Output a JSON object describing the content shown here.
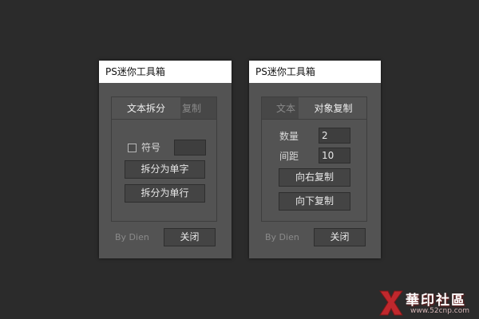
{
  "left_panel": {
    "title": "PS迷你工具箱",
    "tabs": [
      {
        "label": "文本拆分",
        "active": true
      },
      {
        "label": "复制",
        "active": false
      }
    ],
    "symbol_checkbox_label": "符号",
    "symbol_checked": false,
    "symbol_value": "",
    "buttons": [
      "拆分为单字",
      "拆分为单行"
    ],
    "byline": "By Dien",
    "close_label": "关闭"
  },
  "right_panel": {
    "title": "PS迷你工具箱",
    "tabs": [
      {
        "label": "文本",
        "active": false
      },
      {
        "label": "对象复制",
        "active": true
      }
    ],
    "quantity_label": "数量",
    "quantity_value": "2",
    "spacing_label": "间距",
    "spacing_value": "10",
    "buttons": [
      "向右复制",
      "向下复制"
    ],
    "byline": "By Dien",
    "close_label": "关闭"
  },
  "watermark": {
    "text": "華印社區",
    "url": "www.52cnp.com"
  },
  "colors": {
    "background": "#2b2b2b",
    "panel": "#535353",
    "title_bar": "#ffffff",
    "button": "#444444",
    "watermark_red": "#c0282d"
  }
}
